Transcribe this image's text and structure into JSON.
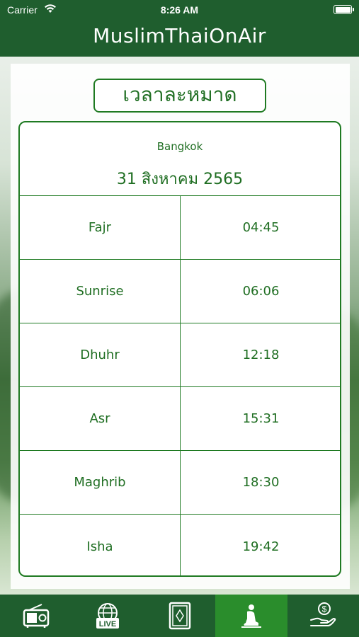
{
  "status_bar": {
    "carrier": "Carrier",
    "time": "8:26 AM"
  },
  "nav": {
    "title": "MuslimThaiOnAir"
  },
  "page": {
    "heading": "เวลาละหมาด"
  },
  "location": {
    "city": "Bangkok",
    "date": "31 สิงหาคม 2565"
  },
  "prayers": [
    {
      "name": "Fajr",
      "time": "04:45"
    },
    {
      "name": "Sunrise",
      "time": "06:06"
    },
    {
      "name": "Dhuhr",
      "time": "12:18"
    },
    {
      "name": "Asr",
      "time": "15:31"
    },
    {
      "name": "Maghrib",
      "time": "18:30"
    },
    {
      "name": "Isha",
      "time": "19:42"
    }
  ],
  "tabs": [
    {
      "icon": "radio-icon",
      "active": false
    },
    {
      "icon": "live-globe-icon",
      "active": false
    },
    {
      "icon": "quran-icon",
      "active": false
    },
    {
      "icon": "prayer-icon",
      "active": true
    },
    {
      "icon": "donate-icon",
      "active": false
    }
  ],
  "tab_labels": {
    "live": "LIVE"
  },
  "colors": {
    "primary": "#1f5e2e",
    "accent": "#1f7a22",
    "active_tab": "#2a8d2c"
  }
}
